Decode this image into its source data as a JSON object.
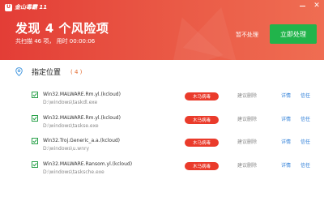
{
  "app": {
    "logo_mark": "U",
    "logo_text": "金山毒霸 11"
  },
  "header": {
    "title": "发现 4 个风险项",
    "subtitle": "共扫描 46 项， 用时 00:00:06",
    "ignore_label": "暂不处理",
    "fix_label": "立即处理",
    "bg_color": "#e33d36",
    "fix_color": "#21b44b"
  },
  "window_controls": {
    "minimize": "minimize-icon",
    "close": "close-icon",
    "close_glyph": "✕"
  },
  "section": {
    "label": "指定位置",
    "count": "( 4 )",
    "icon": "location-pin-icon"
  },
  "risks": [
    {
      "name": "Win32.MALWARE.Rm.yl.(kcloud)",
      "path": "D:\\windows\\taskdl.exe",
      "badge": "木马病毒",
      "suggest": "建议删除",
      "detail": "详情",
      "trust": "信任",
      "checked": true
    },
    {
      "name": "Win32.MALWARE.Rm.yl.(kcloud)",
      "path": "D:\\windows\\taskse.exe",
      "badge": "木马病毒",
      "suggest": "建议删除",
      "detail": "详情",
      "trust": "信任",
      "checked": true
    },
    {
      "name": "Win32.Troj.Generic_a.a.(kcloud)",
      "path": "D:\\windows\\u.wnry",
      "badge": "木马病毒",
      "suggest": "建议删除",
      "detail": "详情",
      "trust": "信任",
      "checked": true
    },
    {
      "name": "Win32.MALWARE.Ransom.yl.(kcloud)",
      "path": "D:\\windows\\tasksche.exe",
      "badge": "木马病毒",
      "suggest": "建议删除",
      "detail": "详情",
      "trust": "信任",
      "checked": true
    }
  ],
  "colors": {
    "badge": "#ea3b2b",
    "link": "#2f7fd8",
    "checkbox": "#2aa14a",
    "count": "#e36a2e"
  }
}
